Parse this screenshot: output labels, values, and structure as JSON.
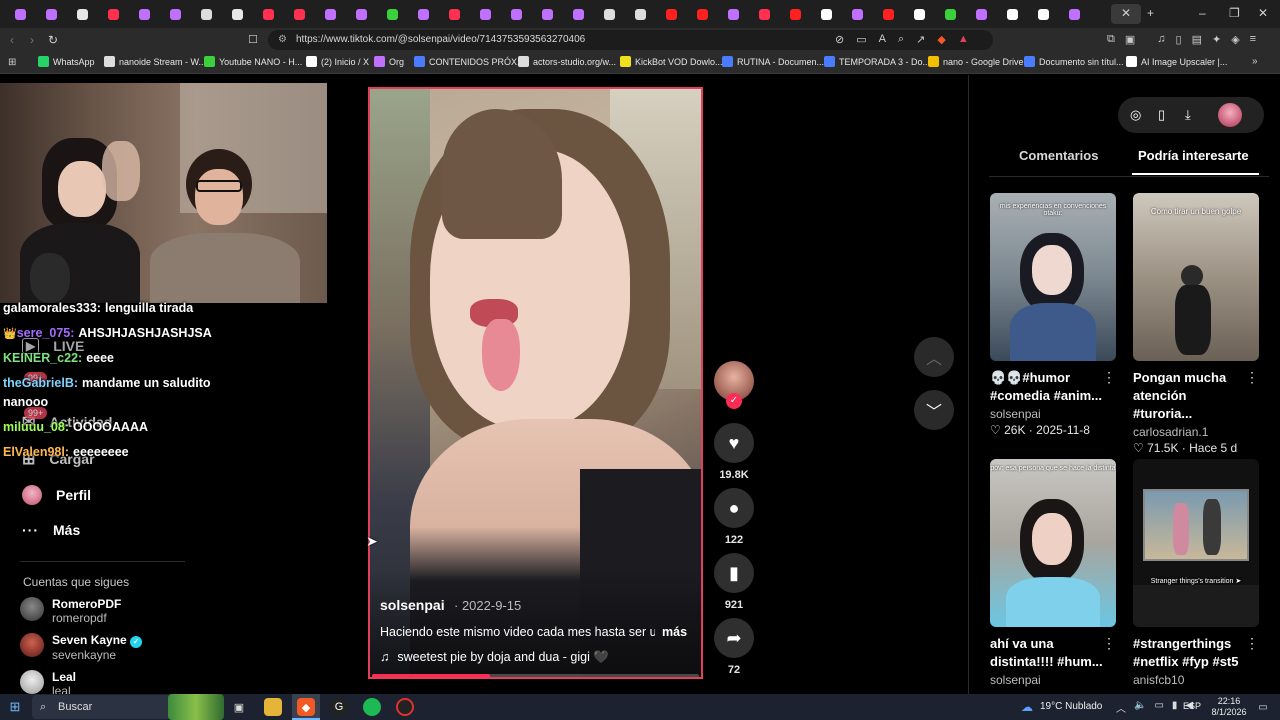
{
  "browser": {
    "url": "https://www.tiktok.com/@solsenpai/video/7143753593563270406",
    "bookmarks": [
      "WhatsApp",
      "nanoide Stream - W...",
      "Youtube NANO - H...",
      "(2) Inicio / X",
      "Org",
      "CONTENIDOS PRÓX...",
      "actors-studio.org/w...",
      "KickBot VOD Dowlo...",
      "RUTINA - Documen...",
      "TEMPORADA 3 - Do...",
      "nano - Google Drive",
      "Documento sin títul...",
      "AI Image Upscaler |..."
    ],
    "tab_close": "✕",
    "new_tab": "+"
  },
  "sidebar": {
    "items": [
      {
        "label": "LIVE",
        "icon": "live-icon"
      },
      {
        "label": "Actividad",
        "icon": "activity-icon",
        "badge": "99+"
      },
      {
        "label": "Cargar",
        "icon": "upload-icon"
      },
      {
        "label": "Perfil",
        "icon": "profile-avatar"
      },
      {
        "label": "Más",
        "icon": "more-icon"
      }
    ],
    "badge_top": "99+",
    "following_title": "Cuentas que sigues",
    "following": [
      {
        "name": "RomeroPDF",
        "handle": "romeropdf"
      },
      {
        "name": "Seven Kayne",
        "handle": "sevenkayne",
        "verified": true
      },
      {
        "name": "Leal",
        "handle": "leal"
      }
    ]
  },
  "chat": [
    {
      "user": "galamorales333:",
      "msg": "lenguilla tirada",
      "color": "#ffffff"
    },
    {
      "user": "sere_075:",
      "msg": "AHSJHJASHJASHJSA",
      "color": "#a56cff",
      "crown": true
    },
    {
      "user": "KEINER_c22:",
      "msg": "eeee",
      "color": "#7ee07e"
    },
    {
      "user": "theGabrielB:",
      "msg": "mandame un saludito",
      "color": "#7fd3ff"
    },
    {
      "user": "",
      "msg": "nanooo",
      "color": "#ffffff"
    },
    {
      "user": "miluuu_08:",
      "msg": "OOOOAAAA",
      "color": "#a0ff5a"
    },
    {
      "user": "ElValen98l:",
      "msg": "eeeeeeee",
      "color": "#ffb84d"
    }
  ],
  "video": {
    "author": "solsenpai",
    "date": "2022-9-15",
    "caption": "Haciendo este mismo video cada mes hasta ser un",
    "more": "más",
    "music": "sweetest pie by doja and dua - gigi 🖤",
    "progress": 0.36
  },
  "actions": {
    "likes": "19.8K",
    "comments": "122",
    "saves": "921",
    "shares": "72"
  },
  "right_panel": {
    "tabs": [
      "Comentarios",
      "Podría interesarte"
    ],
    "active_tab": 1,
    "cards": [
      {
        "title": "💀💀#humor #comedia #anim...",
        "author": "solsenpai",
        "likes": "26K",
        "date": "2025-11-8",
        "overlay": "mis experiencias en convenciones otaku:"
      },
      {
        "title": "Pongan mucha atención #turoria...",
        "author": "carlosadrian.1",
        "likes": "71.5K",
        "date": "Hace 5 d",
        "overlay": "Como tirar un buen golpe"
      },
      {
        "title": "ahí va una distinta!!!! #hum...",
        "author": "solsenpai",
        "likes": "",
        "date": "",
        "overlay": "pov: esa persona que se hace la distinta"
      },
      {
        "title": "#strangerthings #netflix #fyp #st5",
        "author": "anisfcb10",
        "likes": "",
        "date": "",
        "overlay": "Stranger things's transition ➤"
      }
    ]
  },
  "taskbar": {
    "search": "Buscar",
    "weather": "19°C  Nublado",
    "lang": "ESP",
    "time": "22:16",
    "date": "8/1/2026"
  }
}
